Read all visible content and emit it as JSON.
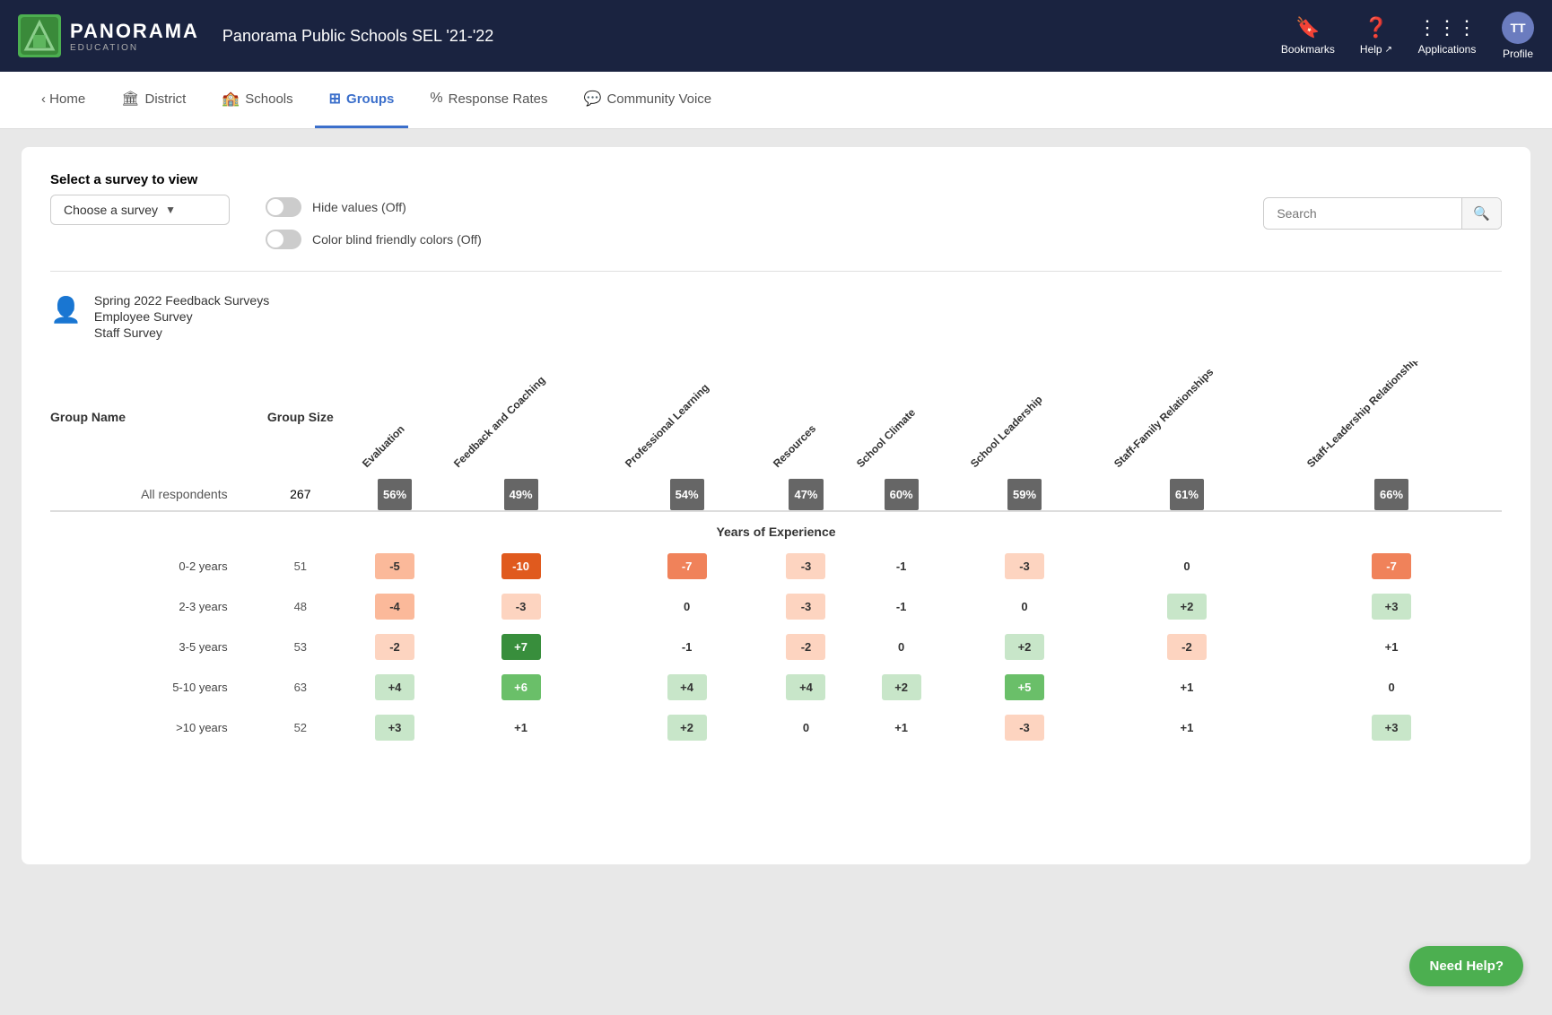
{
  "topNav": {
    "brand": "PANORAMA",
    "brandSub": "EDUCATION",
    "schoolTitle": "Panorama Public Schools SEL '21-'22",
    "bookmarks": "Bookmarks",
    "help": "Help",
    "applications": "Applications",
    "profile": "Profile",
    "profileInitials": "TT"
  },
  "secNav": {
    "home": "‹ Home",
    "district": "District",
    "schools": "Schools",
    "groups": "Groups",
    "responseRates": "Response Rates",
    "communityVoice": "Community Voice",
    "activeTab": "groups"
  },
  "controls": {
    "surveyLabel": "Select a survey to view",
    "surveyPlaceholder": "Choose a survey",
    "hideValuesLabel": "Hide values (Off)",
    "colorBlindLabel": "Color blind friendly colors (Off)",
    "searchPlaceholder": "Search"
  },
  "surveyInfo": {
    "line1": "Spring 2022 Feedback Surveys",
    "line2": "Employee Survey",
    "line3": "Staff Survey"
  },
  "table": {
    "colGroupName": "Group Name",
    "colGroupSize": "Group Size",
    "columns": [
      "Evaluation",
      "Feedback and Coaching",
      "Professional Learning",
      "Resources",
      "School Climate",
      "School Leadership",
      "Staff-Family Relationships",
      "Staff-Leadership Relationships"
    ],
    "allRespondents": {
      "name": "All respondents",
      "size": "267",
      "values": [
        "56%",
        "49%",
        "54%",
        "47%",
        "60%",
        "59%",
        "61%",
        "66%"
      ]
    },
    "sectionHeader": "Years of Experience",
    "rows": [
      {
        "name": "0-2 years",
        "size": "51",
        "values": [
          "-5",
          "-10",
          "-7",
          "-3",
          "-1",
          "-3",
          "0",
          "-7"
        ],
        "colors": [
          "orange-light",
          "orange-dark",
          "orange",
          "peach",
          "neutral",
          "peach",
          "neutral",
          "orange"
        ]
      },
      {
        "name": "2-3 years",
        "size": "48",
        "values": [
          "-4",
          "-3",
          "0",
          "-3",
          "-1",
          "0",
          "+2",
          "+3"
        ],
        "colors": [
          "orange-light",
          "peach",
          "neutral",
          "peach",
          "neutral",
          "neutral",
          "green-light",
          "green-light"
        ]
      },
      {
        "name": "3-5 years",
        "size": "53",
        "values": [
          "-2",
          "+7",
          "-1",
          "-2",
          "0",
          "+2",
          "-2",
          "+1"
        ],
        "colors": [
          "peach",
          "green-dark",
          "neutral",
          "peach",
          "neutral",
          "green-light",
          "peach",
          "neutral"
        ]
      },
      {
        "name": "5-10 years",
        "size": "63",
        "values": [
          "+4",
          "+6",
          "+4",
          "+4",
          "+2",
          "+5",
          "+1",
          "0"
        ],
        "colors": [
          "green-light",
          "green",
          "green-light",
          "green-light",
          "green-light",
          "green",
          "neutral",
          "neutral"
        ]
      },
      {
        "name": ">10 years",
        "size": "52",
        "values": [
          "+3",
          "+1",
          "+2",
          "0",
          "+1",
          "-3",
          "+1",
          "+3"
        ],
        "colors": [
          "green-light",
          "neutral",
          "green-light",
          "neutral",
          "neutral",
          "peach",
          "neutral",
          "green-light"
        ]
      }
    ]
  },
  "needHelp": "Need Help?"
}
